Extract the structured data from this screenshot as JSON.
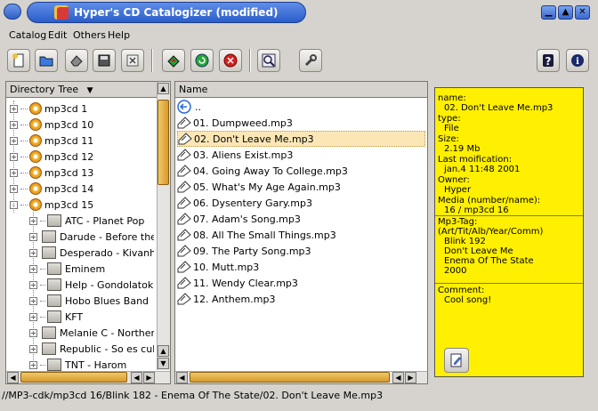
{
  "window": {
    "title": "Hyper's CD Catalogizer (modified)",
    "controls": [
      "minimize",
      "maximize",
      "close"
    ]
  },
  "menu": [
    "Catalog",
    "Edit",
    "Others",
    "Help"
  ],
  "toolbar": {
    "buttons": [
      "new-icon",
      "open-icon",
      "erase-icon",
      "save-icon",
      "close-icon",
      "scan-icon",
      "refresh-icon",
      "stop-icon",
      "search-icon",
      "settings-icon",
      "help-icon",
      "info-icon"
    ]
  },
  "tree": {
    "header": "Directory Tree",
    "cds": [
      {
        "label": "mp3cd 1",
        "expander": "+"
      },
      {
        "label": "mp3cd 10",
        "expander": "+"
      },
      {
        "label": "mp3cd 11",
        "expander": "+"
      },
      {
        "label": "mp3cd 12",
        "expander": "+"
      },
      {
        "label": "mp3cd 13",
        "expander": "+"
      },
      {
        "label": "mp3cd 14",
        "expander": "+"
      },
      {
        "label": "mp3cd 15",
        "expander": "-"
      }
    ],
    "folders": [
      "ATC - Planet Pop",
      "Darude - Before the stor",
      "Desperado - Kivanhatsz",
      "Eminem",
      "Help - Gondolatok",
      "Hobo Blues Band",
      "KFT",
      "Melanie C - Northern St",
      "Republic - So es cukor",
      "TNT - Harom"
    ]
  },
  "list": {
    "header": "Name",
    "up": "..",
    "files": [
      "01. Dumpweed.mp3",
      "02. Don't Leave Me.mp3",
      "03. Aliens Exist.mp3",
      "04. Going Away To College.mp3",
      "05. What's My Age Again.mp3",
      "06. Dysentery Gary.mp3",
      "07. Adam's Song.mp3",
      "08. All The Small Things.mp3",
      "09. The Party Song.mp3",
      "10. Mutt.mp3",
      "11. Wendy Clear.mp3",
      "12. Anthem.mp3"
    ],
    "selected_index": 1
  },
  "info": {
    "name_label": "name:",
    "name_value": "02. Don't Leave Me.mp3",
    "type_label": "type:",
    "type_value": "File",
    "size_label": "Size:",
    "size_value": "2.19  Mb",
    "mod_label": "Last moification:",
    "mod_value": "jan.4 11:48 2001",
    "owner_label": "Owner:",
    "owner_value": "Hyper",
    "media_label": "Media (number/name):",
    "media_value": "16 / mp3cd 16",
    "tag_label": "Mp3-Tag:",
    "tag_fields": "(Art/Tit/Alb/Year/Comm)",
    "tag_artist": "Blink 192",
    "tag_title": "Don't Leave Me",
    "tag_album": "Enema Of The State",
    "tag_year": "2000",
    "comment_label": "Comment:",
    "comment_value": "Cool song!"
  },
  "status": "//MP3-cdk/mp3cd 16/Blink 182 - Enema Of The State/02. Don't Leave Me.mp3",
  "colors": {
    "title_blue": "#2a5dc9",
    "info_yellow": "#ffef00",
    "scroll_orange": "#e0a83a",
    "selection": "#fbe7b6"
  }
}
